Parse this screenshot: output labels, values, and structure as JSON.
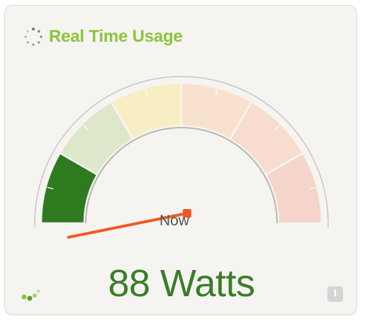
{
  "widget": {
    "title": "Real Time Usage",
    "title_color": "#8cc43c",
    "now_label": "Now",
    "reading": "88 Watts",
    "reading_color": "#3a7d27"
  },
  "gauge": {
    "level_fraction": 0.03,
    "active_segment": 0,
    "segments": [
      {
        "color": "#2e7a1f"
      },
      {
        "color": "#dde8cb"
      },
      {
        "color": "#f7eec4"
      },
      {
        "color": "#f9e2cd"
      },
      {
        "color": "#f8dcd0"
      },
      {
        "color": "#f5d4ca"
      }
    ],
    "needle_color": "#ef5a24"
  },
  "icons": {
    "loading": "spinner-icon",
    "status": "dots-icon",
    "info": "info-icon",
    "info_glyph": "i"
  }
}
